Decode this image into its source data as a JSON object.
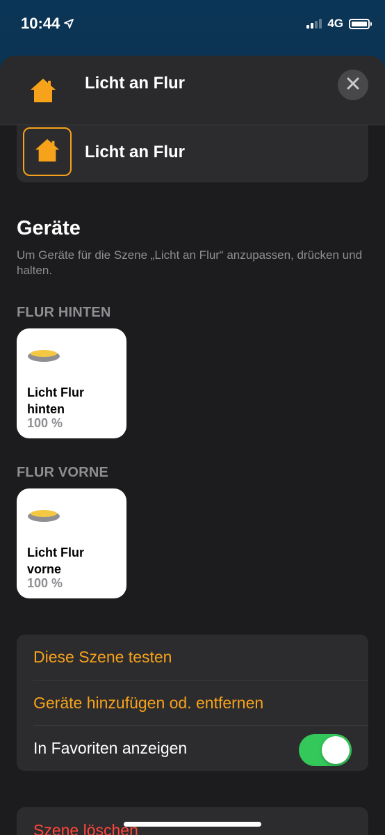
{
  "status_bar": {
    "time": "10:44",
    "network": "4G",
    "signal_bars_active": 2,
    "signal_bars_total": 4,
    "battery_level": 1.0
  },
  "header": {
    "title": "Licht an Flur",
    "icon": "house-icon",
    "close_icon": "close-icon"
  },
  "scene_name": {
    "value": "Licht an Flur",
    "icon": "house-icon"
  },
  "devices_section": {
    "title": "Geräte",
    "description": "Um Geräte für die Szene „Licht an Flur“ anzupassen, drücken und halten."
  },
  "groups": [
    {
      "label": "FLUR HINTEN",
      "tile": {
        "name": "Licht Flur hinten",
        "status": "100 %",
        "icon": "ceiling-light-icon"
      }
    },
    {
      "label": "FLUR VORNE",
      "tile": {
        "name": "Licht Flur vorne",
        "status": "100 %",
        "icon": "ceiling-light-icon"
      }
    }
  ],
  "options": {
    "test_scene": "Diese Szene testen",
    "add_remove_devices": "Geräte hinzufügen od. entfernen",
    "show_in_favorites": "In Favoriten anzeigen",
    "show_in_favorites_enabled": true
  },
  "delete": {
    "label": "Szene löschen"
  },
  "colors": {
    "accent": "#f7a21b",
    "toggle_on": "#34c759",
    "destructive": "#ff453a",
    "sheet_bg": "#1c1c1e",
    "card_bg": "#2c2c2e"
  }
}
